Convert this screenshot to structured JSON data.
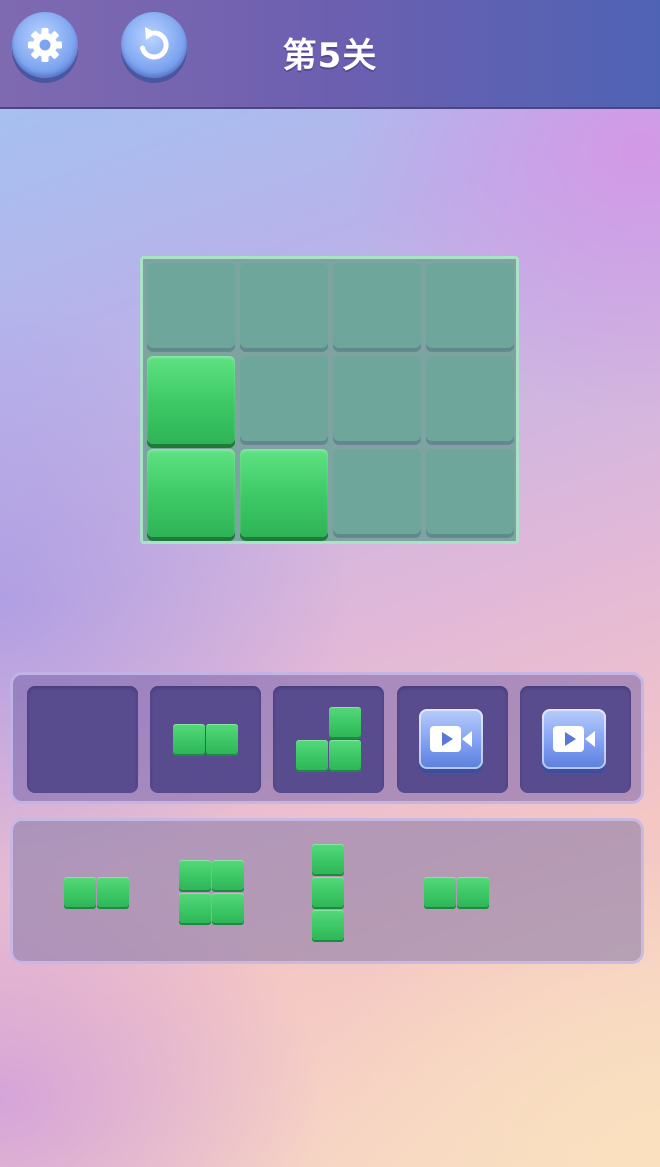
{
  "header": {
    "level_title": "第5关",
    "settings_icon": "gear-icon",
    "undo_icon": "undo-icon"
  },
  "board": {
    "rows": 3,
    "cols": 4,
    "filled_cells": [
      [
        1,
        0
      ],
      [
        2,
        0
      ],
      [
        2,
        1
      ]
    ]
  },
  "slots": [
    {
      "type": "empty"
    },
    {
      "type": "piece",
      "shape": "horizontal-domino"
    },
    {
      "type": "piece",
      "shape": "l-tromino"
    },
    {
      "type": "video",
      "icon": "video-ad-icon"
    },
    {
      "type": "video",
      "icon": "video-ad-icon"
    }
  ],
  "pieces": [
    {
      "shape": "horizontal-domino"
    },
    {
      "shape": "square-tetromino"
    },
    {
      "shape": "vertical-i-tromino"
    },
    {
      "shape": "horizontal-domino"
    }
  ],
  "colors": {
    "block_green": "#3dc865",
    "empty_cell": "#6fa69c",
    "header": "#6d5fb0"
  }
}
